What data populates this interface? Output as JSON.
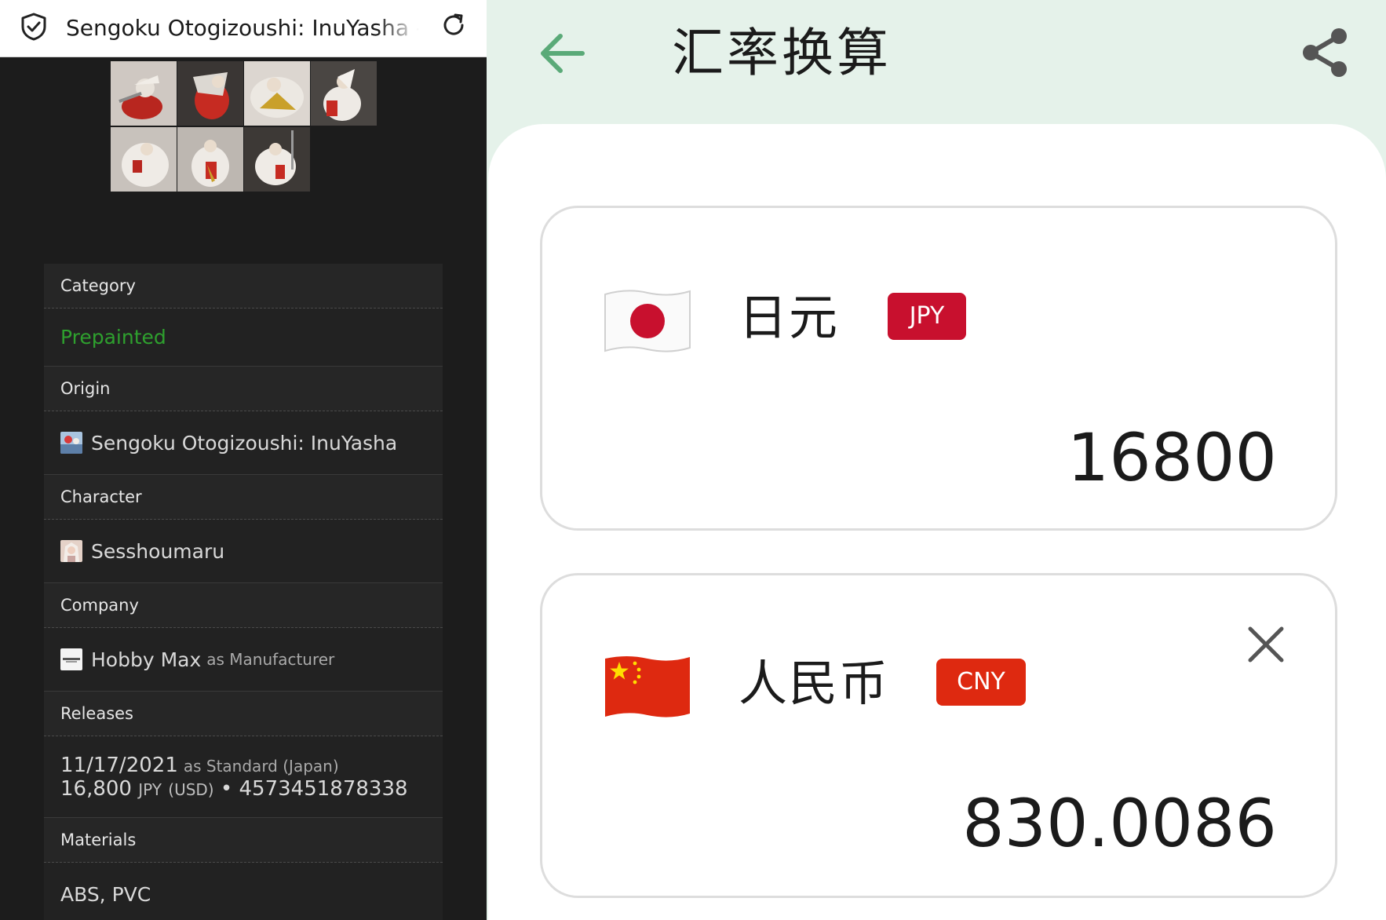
{
  "browser": {
    "tab_title": "Sengoku Otogizoushi: InuYasha - Sesshoumaru",
    "icons": {
      "security": "shield-check-icon",
      "reload": "reload-icon"
    }
  },
  "gallery": {
    "thumbnail_count": 7
  },
  "info_table": {
    "category": {
      "label": "Category",
      "value": "Prepainted"
    },
    "origin": {
      "label": "Origin",
      "value": "Sengoku Otogizoushi: InuYasha"
    },
    "character": {
      "label": "Character",
      "value": "Sesshoumaru"
    },
    "company": {
      "label": "Company",
      "name": "Hobby Max",
      "role": "as Manufacturer"
    },
    "releases": {
      "label": "Releases",
      "date": "11/17/2021",
      "edition": "as Standard (Japan)",
      "price": "16,800",
      "currency": "JPY",
      "currency_extra": "(USD)",
      "separator": "•",
      "barcode": "4573451878338"
    },
    "materials": {
      "label": "Materials",
      "value": "ABS, PVC"
    }
  },
  "converter": {
    "title": "汇率换算",
    "icons": {
      "back": "back-arrow-icon",
      "share": "share-icon",
      "close": "close-icon"
    },
    "from": {
      "name": "日元",
      "code": "JPY",
      "amount": "16800",
      "flag": "japan-flag-icon",
      "badge_color": "#c8102e"
    },
    "to": {
      "name": "人民币",
      "code": "CNY",
      "amount": "830.0086",
      "flag": "china-flag-icon",
      "badge_color": "#de2910"
    },
    "colors": {
      "header_bg": "#e5f2ea",
      "back_arrow": "#5aaa78"
    }
  }
}
